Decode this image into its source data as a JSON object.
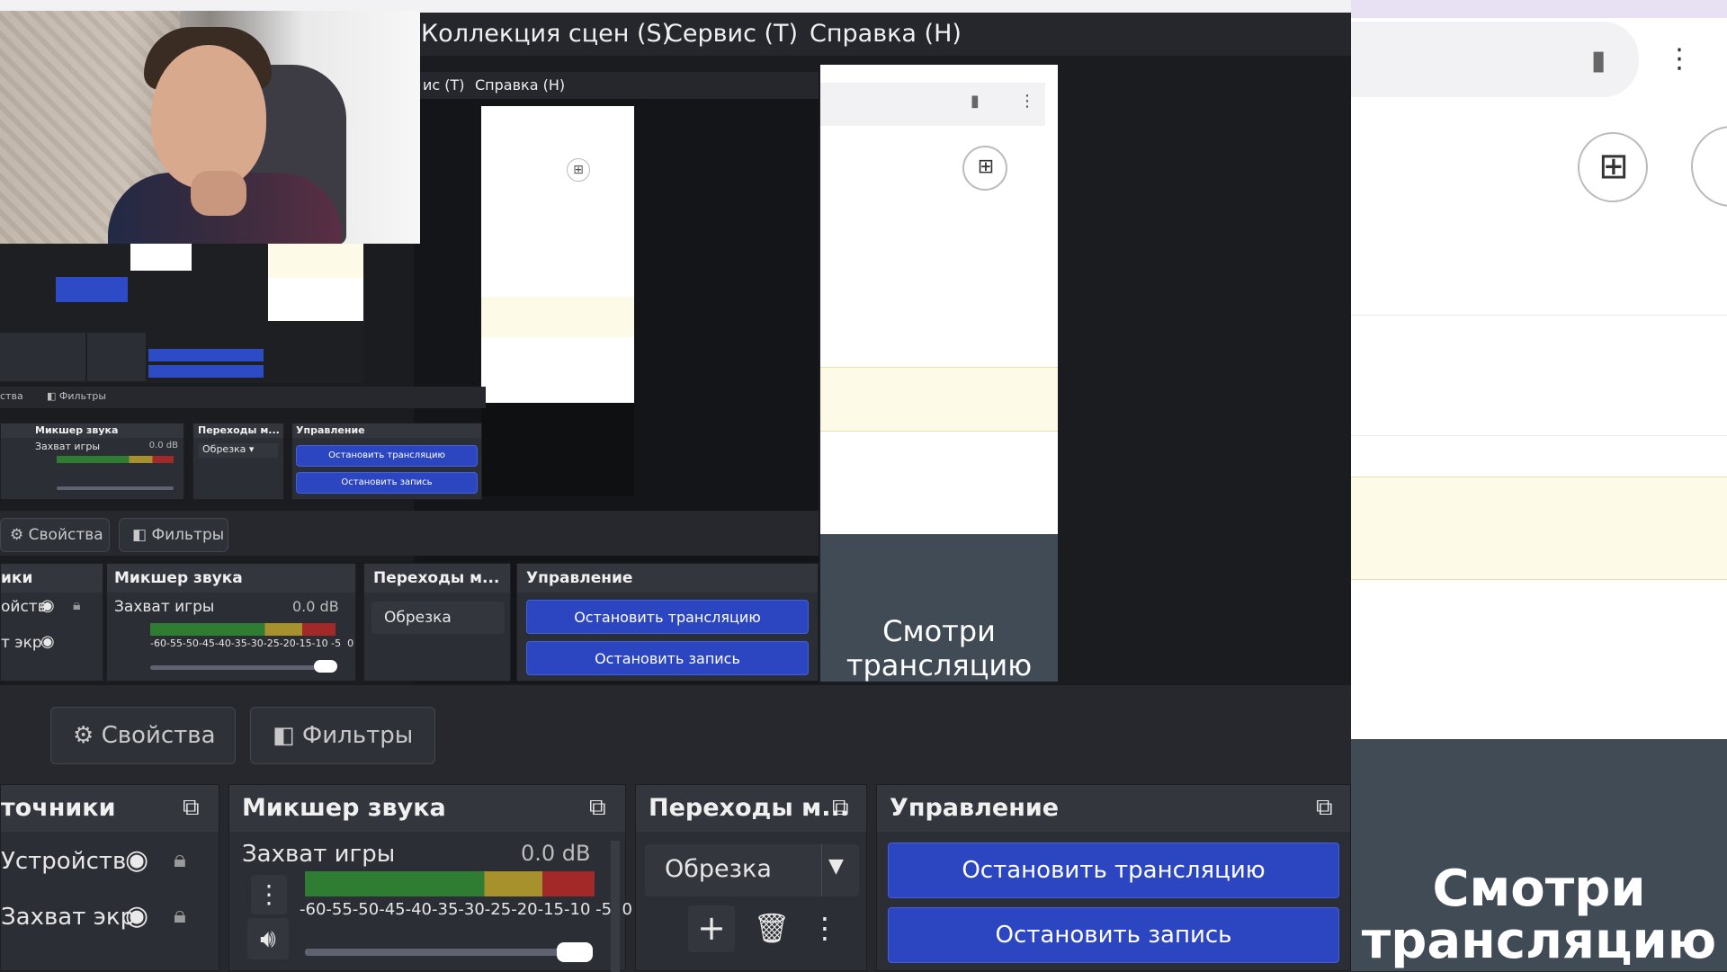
{
  "menubar": {
    "items": [
      "Коллекция сцен (S)",
      "Сервис (T)",
      "Справка (H)"
    ]
  },
  "preview_nested_menubar": {
    "items": [
      "ис (T)",
      "Справка (H)"
    ]
  },
  "tabs": {
    "properties": "Свойства",
    "filters": "Фильтры"
  },
  "docks": {
    "sources": {
      "title": "точники",
      "items": [
        "Устройств",
        "Захват экр"
      ]
    },
    "sources_mid": {
      "title": "ики",
      "items": [
        "ойств",
        "т экр"
      ]
    },
    "mixer": {
      "title": "Микшер звука",
      "channel": "Захват игры",
      "level": "0.0 dB",
      "scale": "-60-55-50-45-40-35-30-25-20-15-10 -5  0",
      "volume": 0.95
    },
    "transitions": {
      "title": "Переходы м...",
      "selected": "Обрезка"
    },
    "controls": {
      "title": "Управление",
      "stop_stream": "Остановить трансляцию",
      "stop_record": "Остановить запись"
    }
  },
  "browser": {
    "watch_text": "Смотри трансляцию"
  },
  "icons": [
    "gear-icon",
    "filter-icon",
    "eye-icon",
    "lock-icon",
    "dock-undock-icon",
    "plus-icon",
    "trash-icon",
    "kebab-icon",
    "speaker-icon",
    "chevron-down-icon",
    "bookmark-icon",
    "add-square-icon",
    "bell-icon"
  ]
}
